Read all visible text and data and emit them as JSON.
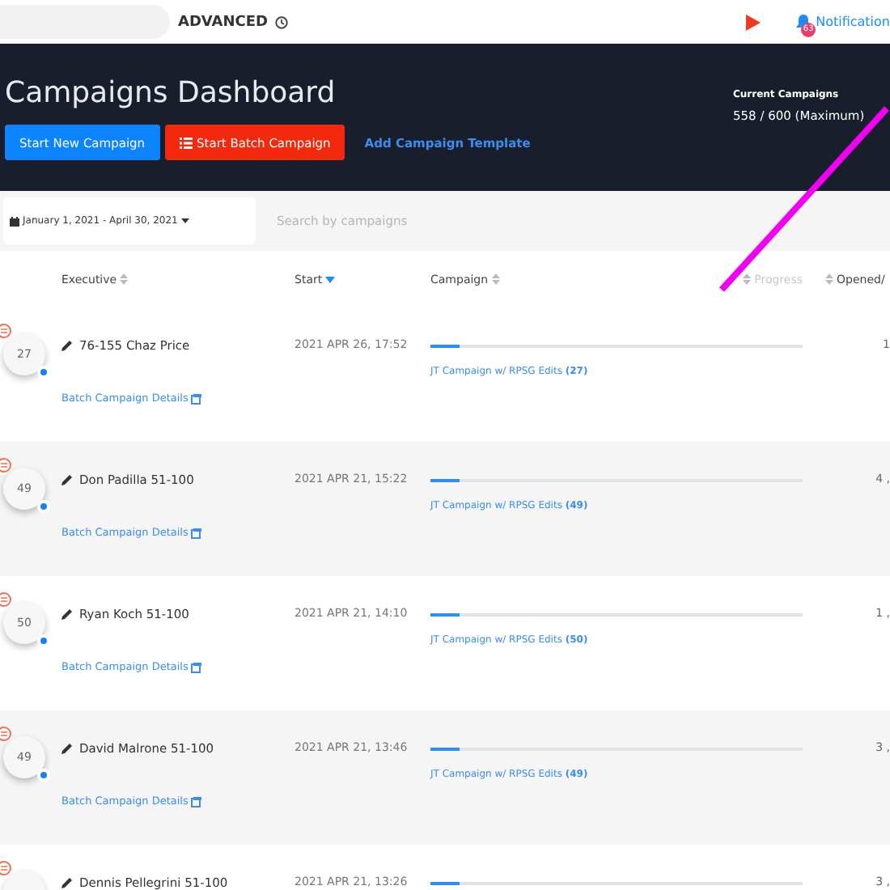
{
  "topbar": {
    "mode": "ADVANCED",
    "notification_count": "63",
    "notification_label": "Notification"
  },
  "header": {
    "title": "Campaigns Dashboard",
    "buttons": [
      {
        "label": "Start New Campaign",
        "kind": "primary"
      },
      {
        "label": "Start Batch Campaign",
        "kind": "danger"
      },
      {
        "label": "Add Campaign Template",
        "kind": "link"
      }
    ],
    "current_label": "Current Campaigns",
    "current_value": "558 / 600 (Maximum)"
  },
  "filters": {
    "date_range": "January 1, 2021 - April 30, 2021",
    "search_placeholder": "Search by campaigns"
  },
  "table": {
    "columns": [
      {
        "label": "Executive",
        "sorted": false
      },
      {
        "label": "Start",
        "sorted": true
      },
      {
        "label": "Campaign",
        "sorted": false
      },
      {
        "label": "Progress",
        "sorted": false
      },
      {
        "label": "Opened/",
        "sorted": false
      }
    ],
    "rows": [
      {
        "count": "27",
        "executive": "76-155 Chaz Price",
        "start": "2021 APR 26, 17:52",
        "level": 0.08,
        "campaign": "JT Campaign w/ RPSG Edits **(27)**",
        "opened": "1",
        "details": "Batch Campaign Details"
      },
      {
        "count": "49",
        "executive": "Don Padilla 51-100",
        "start": "2021 APR 21, 15:22",
        "level": 0.08,
        "campaign": "JT Campaign w/ RPSG Edits **(49)**",
        "opened": "4 ,",
        "details": "Batch Campaign Details"
      },
      {
        "count": "50",
        "executive": "Ryan Koch 51-100",
        "start": "2021 APR 21, 14:10",
        "level": 0.08,
        "campaign": "JT Campaign w/ RPSG Edits **(50)**",
        "opened": "1 ,",
        "details": "Batch Campaign Details"
      },
      {
        "count": "49",
        "executive": "David Malrone 51-100",
        "start": "2021 APR 21, 13:46",
        "level": 0.08,
        "campaign": "JT Campaign w/ RPSG Edits **(49)**",
        "opened": "3 ,",
        "details": "Batch Campaign Details"
      },
      {
        "executive": "Dennis Pellegrini 51-100",
        "start": "2021 APR 21, 13:26",
        "level": 0.08,
        "opened": "3 ,"
      }
    ]
  }
}
